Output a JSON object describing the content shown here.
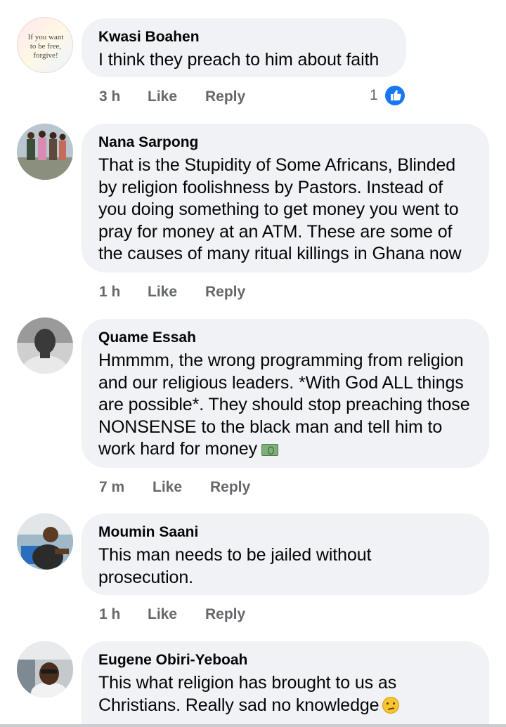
{
  "colors": {
    "bubble": "#f0f2f5",
    "meta_text": "#65676b",
    "like_badge": "#1877f2"
  },
  "comments": [
    {
      "author": "Kwasi Boahen",
      "avatar_text": "If you want to be free, forgive!",
      "text": "I think they preach to him about faith",
      "time": "3 h",
      "like_label": "Like",
      "reply_label": "Reply",
      "reaction_count": "1",
      "reaction_icon": "thumbs-up-icon"
    },
    {
      "author": "Nana Sarpong",
      "text": "That is the Stupidity of Some Africans, Blinded by religion foolishness by Pastors. Instead of you doing something to get money you went to pray for money at an ATM. These are some of the causes of many ritual killings in Ghana now",
      "time": "1 h",
      "like_label": "Like",
      "reply_label": "Reply"
    },
    {
      "author": "Quame Essah",
      "text": "Hmmmm, the wrong programming from religion and our religious leaders. *With God ALL things are possible*. They should stop preaching those NONSENSE to the black man and tell him to work hard for money",
      "trailing_emoji": "money-emoji",
      "time": "7 m",
      "like_label": "Like",
      "reply_label": "Reply"
    },
    {
      "author": "Moumin Saani",
      "text": "This man needs to be jailed without prosecution.",
      "time": "1 h",
      "like_label": "Like",
      "reply_label": "Reply"
    },
    {
      "author": "Eugene Obiri-Yeboah",
      "text": "This what religion has brought to us as Christians. Really sad no knowledge",
      "trailing_emoji": "unamused-face-emoji"
    }
  ]
}
